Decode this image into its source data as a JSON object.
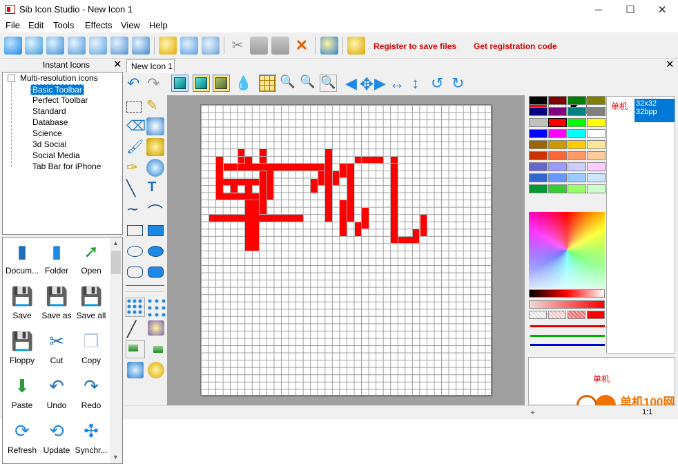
{
  "window": {
    "title": "Sib Icon Studio - New Icon 1",
    "minimize": "─",
    "maximize": "☐",
    "close": "✕"
  },
  "menu": [
    "File",
    "Edit",
    "Tools",
    "Effects",
    "View",
    "Help"
  ],
  "toolbar": {
    "register": "Register to save files",
    "get_code": "Get registration code"
  },
  "instant_icons": {
    "title": "Instant Icons",
    "close": "✕",
    "tree_root_toggle": "⊟",
    "tree_root": "Multi-resolution icons",
    "tree_items": [
      "Basic Toolbar",
      "Perfect Toolbar",
      "Standard",
      "Database",
      "Science",
      "3d Social",
      "Social Media",
      "Tab Bar for iPhone"
    ],
    "selected_item": "Basic Toolbar"
  },
  "gallery": [
    {
      "label": "Docum...",
      "icon": "document-icon"
    },
    {
      "label": "Folder",
      "icon": "folder-icon"
    },
    {
      "label": "Open",
      "icon": "open-icon"
    },
    {
      "label": "Save",
      "icon": "save-icon"
    },
    {
      "label": "Save as",
      "icon": "save-as-icon"
    },
    {
      "label": "Save all",
      "icon": "save-all-icon"
    },
    {
      "label": "Floppy",
      "icon": "floppy-icon"
    },
    {
      "label": "Cut",
      "icon": "scissors-icon"
    },
    {
      "label": "Copy",
      "icon": "copy-icon"
    },
    {
      "label": "Paste",
      "icon": "paste-icon"
    },
    {
      "label": "Undo",
      "icon": "undo-icon"
    },
    {
      "label": "Redo",
      "icon": "redo-icon"
    },
    {
      "label": "Refresh",
      "icon": "refresh-icon"
    },
    {
      "label": "Update",
      "icon": "update-icon"
    },
    {
      "label": "Synchr...",
      "icon": "synchronize-icon"
    }
  ],
  "document": {
    "tab": "New Icon 1",
    "tab_close": "✕"
  },
  "canvas_text": "单机",
  "colors": {
    "accent": "#0078d7",
    "drawing": "#ff0000",
    "foreground": "#ff0000"
  },
  "palette": [
    [
      "#000000",
      "#800000",
      "#008000",
      "#808000"
    ],
    [
      "#000080",
      "#800080",
      "#008080",
      "#808080"
    ],
    [
      "#c0c0c0",
      "#ff0000",
      "#00ff00",
      "#ffff00"
    ],
    [
      "#0000ff",
      "#ff00ff",
      "#00ffff",
      "#ffffff"
    ],
    [
      "#996600",
      "#cc9900",
      "#ffcc00",
      "#ffe699"
    ],
    [
      "#cc3300",
      "#ff6633",
      "#ff9966",
      "#ffcc99"
    ],
    [
      "#6666cc",
      "#9999ff",
      "#ccccff",
      "#ffccff"
    ],
    [
      "#3366cc",
      "#6699ff",
      "#99ccff",
      "#cce6ff"
    ],
    [
      "#009933",
      "#33cc33",
      "#99ff66",
      "#ccffcc"
    ]
  ],
  "sizes": {
    "label": "单机",
    "resolution": "32x32",
    "depth": "32bpp"
  },
  "preview_text": "单机",
  "watermark": "单机100网",
  "status": {
    "page": "1:1"
  }
}
